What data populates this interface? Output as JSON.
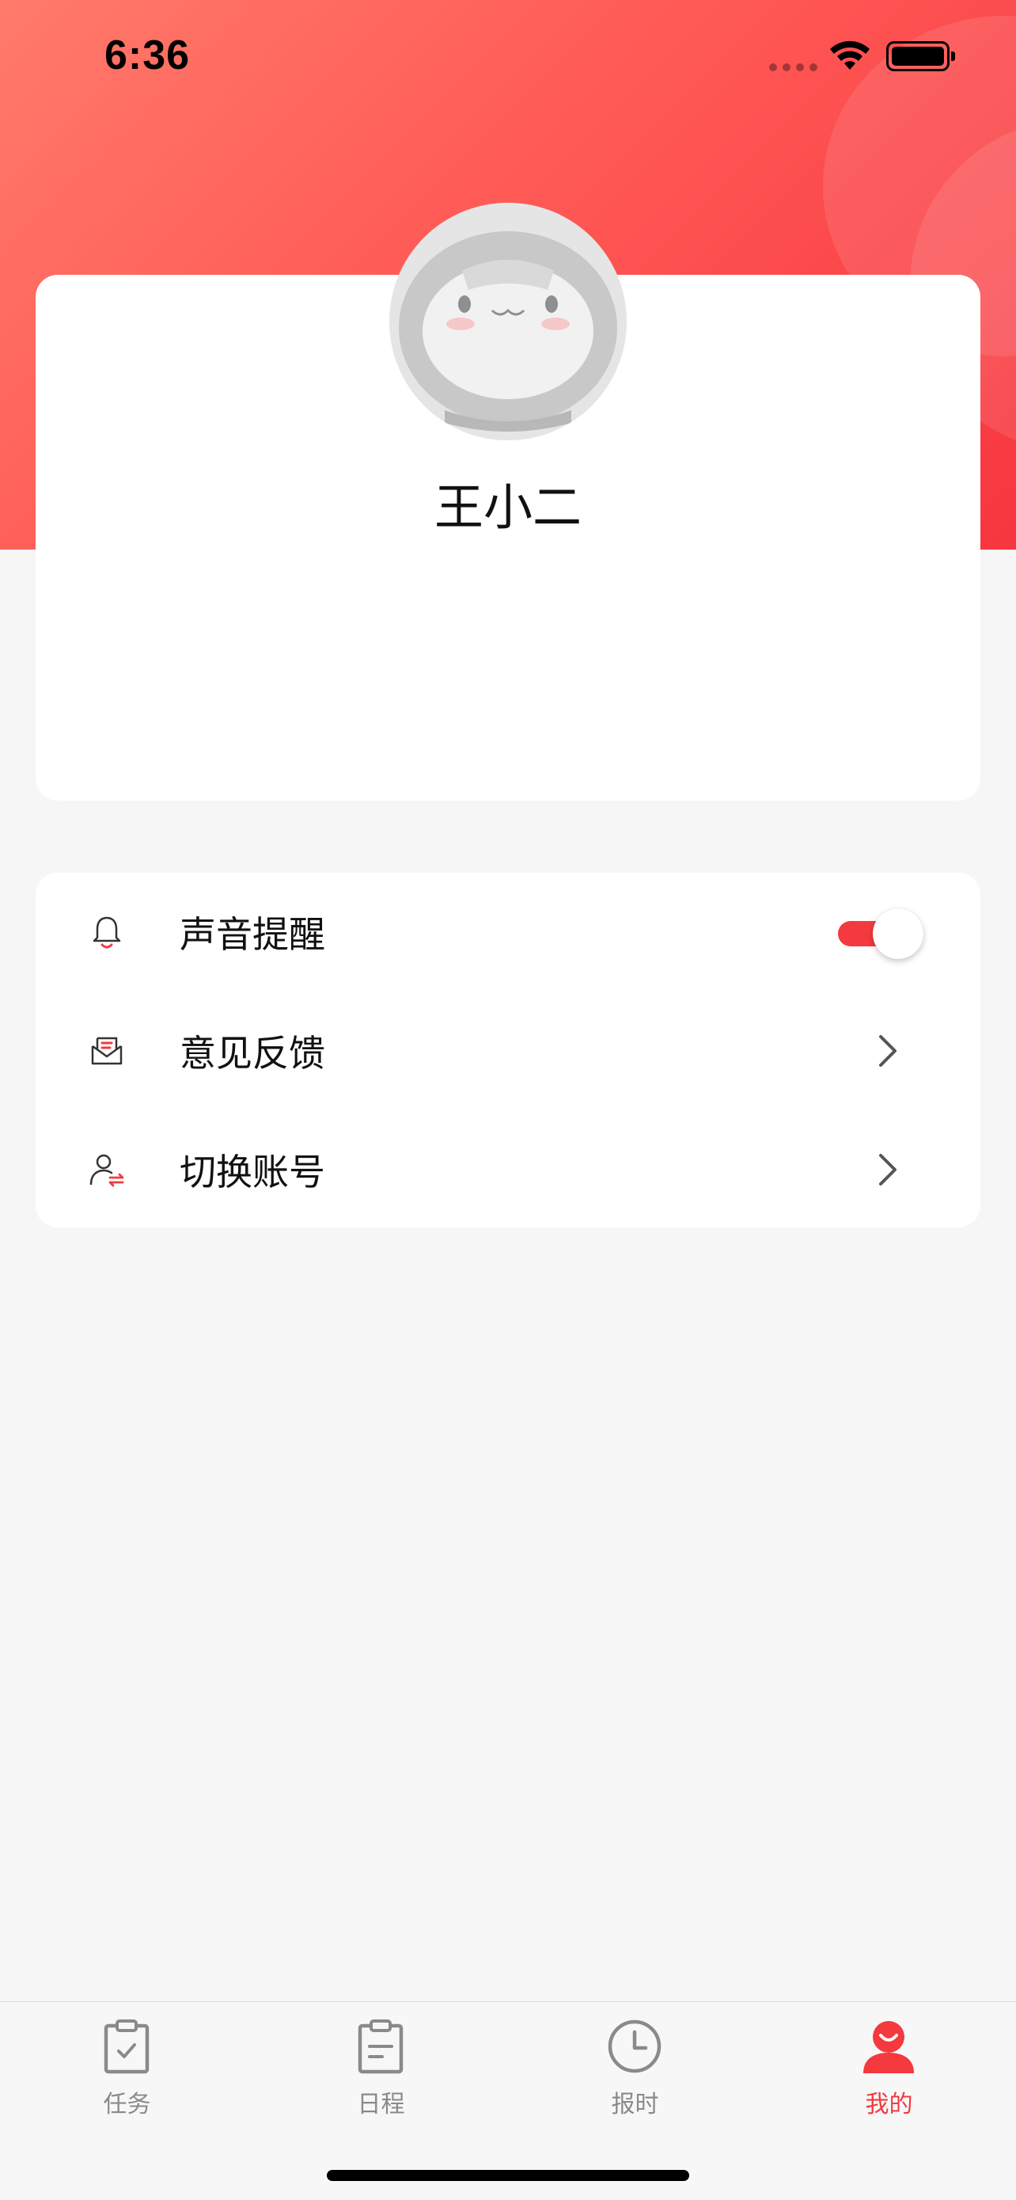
{
  "status_bar": {
    "time": "6:36",
    "icons": [
      "signal-dots-icon",
      "wifi-icon",
      "battery-icon"
    ]
  },
  "profile": {
    "name": "王小二",
    "avatar": "cat-face-avatar"
  },
  "settings": {
    "items": [
      {
        "label": "声音提醒",
        "icon": "bell-icon",
        "control": "toggle",
        "toggle_on": true
      },
      {
        "label": "意见反馈",
        "icon": "mail-icon",
        "control": "chevron"
      },
      {
        "label": "切换账号",
        "icon": "switch-user-icon",
        "control": "chevron"
      }
    ]
  },
  "tab_bar": {
    "tabs": [
      {
        "label": "任务",
        "icon": "clipboard-check-icon",
        "active": false
      },
      {
        "label": "日程",
        "icon": "clipboard-list-icon",
        "active": false
      },
      {
        "label": "报时",
        "icon": "clock-icon",
        "active": false
      },
      {
        "label": "我的",
        "icon": "user-icon",
        "active": true
      }
    ]
  },
  "colors": {
    "accent": "#f4393f",
    "header_gradient_start": "#ff7a6a",
    "header_gradient_end": "#f7363f",
    "background": "#f6f6f6",
    "inactive_tab": "#8a8a8a"
  }
}
